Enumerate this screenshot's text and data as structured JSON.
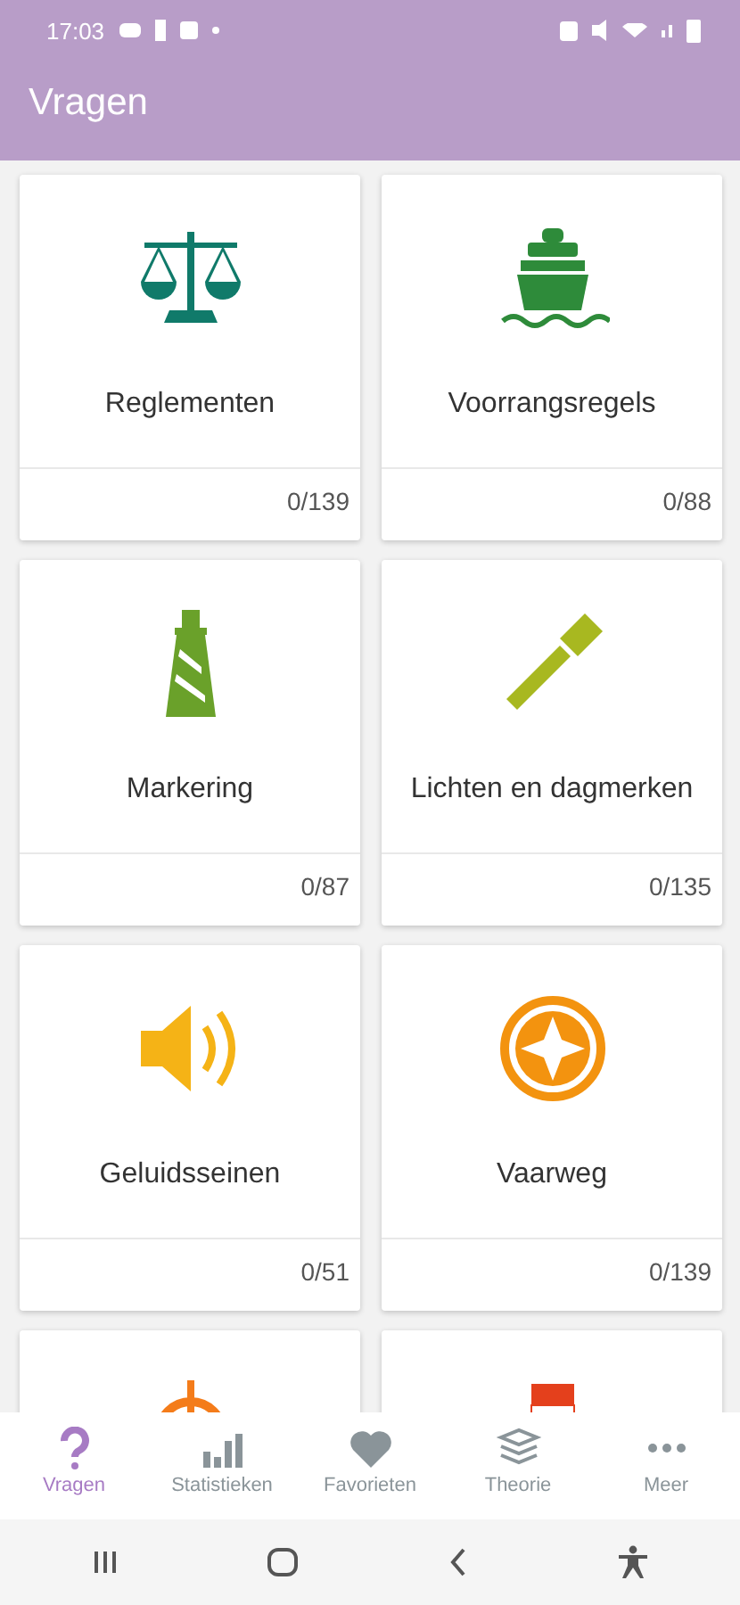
{
  "status_bar": {
    "time": "17:03"
  },
  "app_bar": {
    "title": "Vragen"
  },
  "categories": [
    {
      "kind": "scale",
      "color": "#107a6a",
      "label": "Reglementen",
      "count": "0/139"
    },
    {
      "kind": "ship",
      "color": "#2e8b3a",
      "label": "Voorrangsregels",
      "count": "0/88"
    },
    {
      "kind": "lighthouse",
      "color": "#6aa12a",
      "label": "Markering",
      "count": "0/87"
    },
    {
      "kind": "flashlight",
      "color": "#a8b820",
      "label": "Lichten en dagmerken",
      "count": "0/135"
    },
    {
      "kind": "speaker",
      "color": "#f5b316",
      "label": "Geluidsseinen",
      "count": "0/51"
    },
    {
      "kind": "compass",
      "color": "#f3930f",
      "label": "Vaarweg",
      "count": "0/139"
    },
    {
      "kind": "wheel",
      "color": "#f47c1a"
    },
    {
      "kind": "flag",
      "color": "#e4401c"
    }
  ],
  "bottom_nav": [
    {
      "kind": "question",
      "label": "Vragen",
      "selected": true
    },
    {
      "kind": "bars",
      "label": "Statistieken",
      "selected": false
    },
    {
      "kind": "heart",
      "label": "Favorieten",
      "selected": false
    },
    {
      "kind": "books",
      "label": "Theorie",
      "selected": false
    },
    {
      "kind": "dots",
      "label": "Meer",
      "selected": false
    }
  ]
}
